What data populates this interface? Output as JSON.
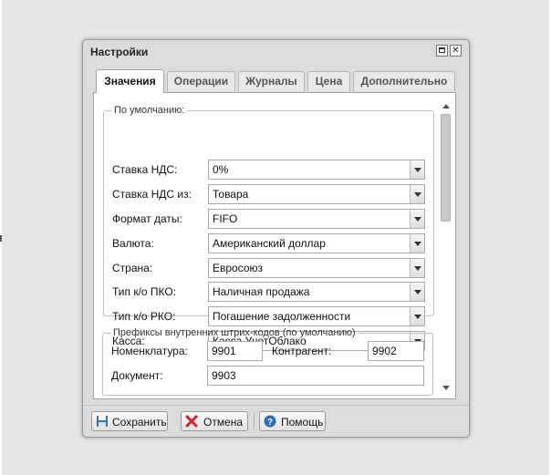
{
  "window": {
    "title": "Настройки"
  },
  "tabs": [
    {
      "label": "Значения",
      "active": true
    },
    {
      "label": "Операции",
      "active": false
    },
    {
      "label": "Журналы",
      "active": false
    },
    {
      "label": "Цена",
      "active": false
    },
    {
      "label": "Дополнительно",
      "active": false
    }
  ],
  "defaults": {
    "legend": "По умолчанию:",
    "fields": [
      {
        "label": "Ставка НДС:",
        "value": "0%"
      },
      {
        "label": "Ставка НДС из:",
        "value": "Товара"
      },
      {
        "label": "Формат даты:",
        "value": "FIFO"
      },
      {
        "label": "Валюта:",
        "value": "Американский доллар"
      },
      {
        "label": "Страна:",
        "value": "Евросоюз"
      },
      {
        "label": "Тип к/о ПКО:",
        "value": "Наличная продажа"
      },
      {
        "label": "Тип к/о РКО:",
        "value": "Погашение задолженности"
      },
      {
        "label": "Касса:",
        "value": "Касса УчетОблако"
      }
    ]
  },
  "barcodes": {
    "legend": "Префиксы внутренних штрих-кодов (по умолчанию)",
    "nomenclature_label": "Номенклатура:",
    "nomenclature_value": "9901",
    "contractor_label": "Контрагент:",
    "contractor_value": "9902",
    "document_label": "Документ:",
    "document_value": "9903"
  },
  "footer": {
    "save_label": "Сохранить",
    "cancel_label": "Отмена",
    "help_label": "Помощь"
  },
  "colors": {
    "save_icon": "#3a6fb5",
    "cancel_icon": "#d2232a",
    "help_icon": "#2f6db5"
  }
}
